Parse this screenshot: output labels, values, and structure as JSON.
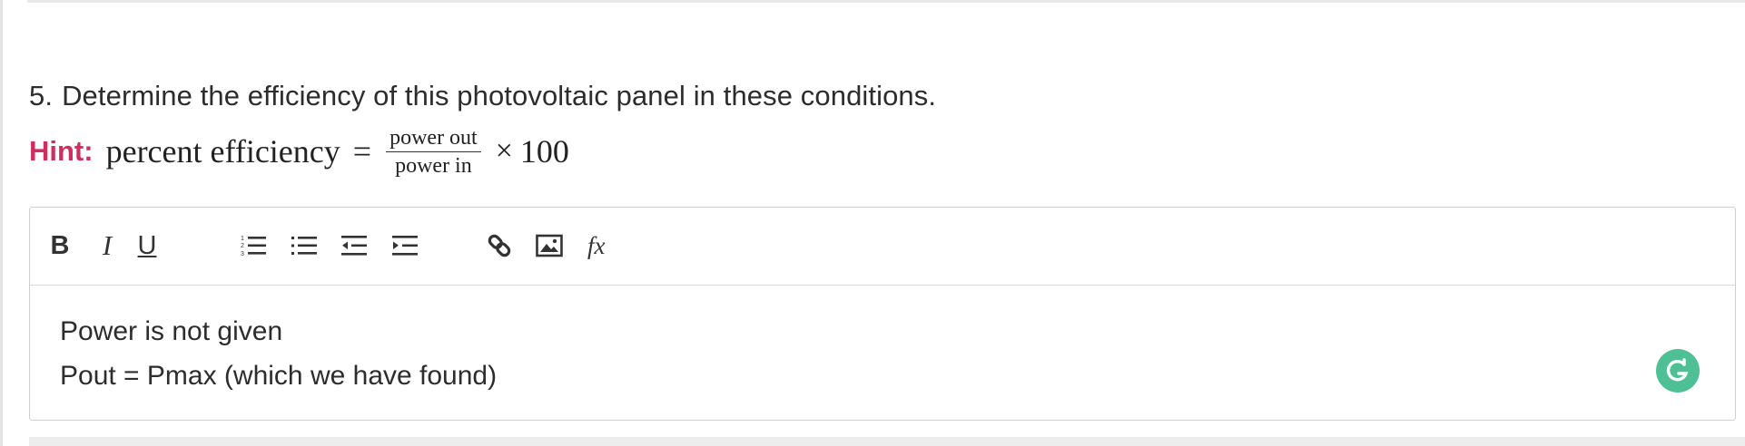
{
  "question": {
    "number": "5.",
    "text": "Determine the efficiency of this photovoltaic panel in these conditions."
  },
  "hint": {
    "label": "Hint:",
    "formula_lhs": "percent efficiency",
    "equals": "=",
    "numerator": "power out",
    "denominator": "power in",
    "times": "×",
    "multiplier": "100"
  },
  "editor": {
    "toolbar": {
      "bold_label": "B",
      "italic_label": "I",
      "underline_label": "U",
      "icons": [
        "numbered-list-icon",
        "bulleted-list-icon",
        "outdent-icon",
        "indent-icon",
        "link-icon",
        "image-icon",
        "formula-icon"
      ]
    },
    "content_lines": [
      "Power is not given",
      "Pout = Pmax (which we have found)"
    ]
  },
  "colors": {
    "hint": "#cc2f60",
    "grammarly": "#4fbf96",
    "text": "#2d2d2d"
  }
}
